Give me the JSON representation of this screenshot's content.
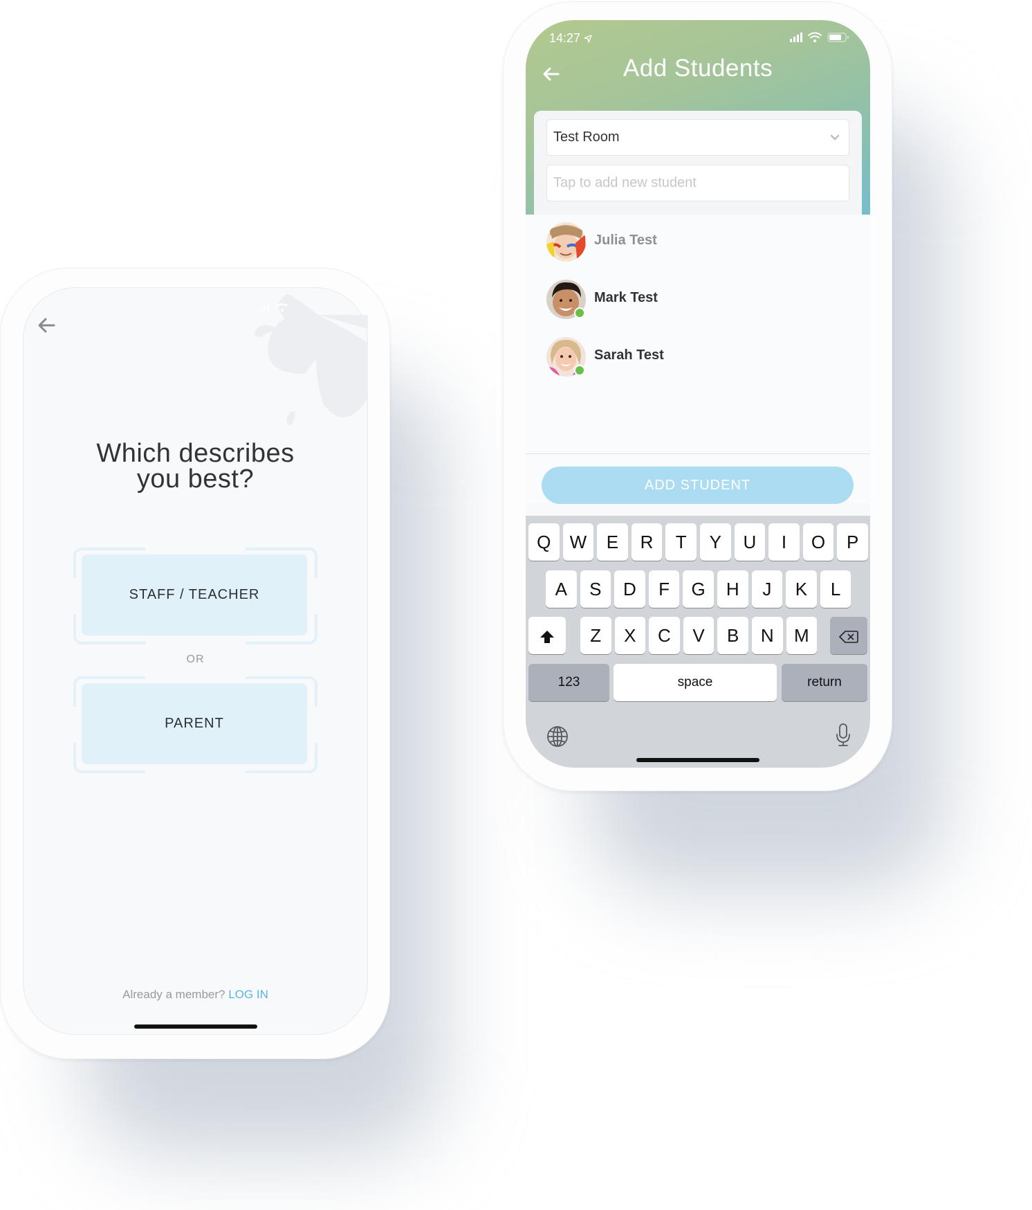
{
  "left_phone": {
    "title_line1": "Which describes",
    "title_line2": "you best?",
    "options": [
      {
        "label": "STAFF / TEACHER"
      },
      {
        "label": "PARENT"
      }
    ],
    "separator": "OR",
    "footer_text": "Already a member?",
    "footer_link": "LOG IN"
  },
  "right_phone": {
    "status": {
      "time": "14:27"
    },
    "header": {
      "title": "Add Students"
    },
    "room_select": {
      "value": "Test Room"
    },
    "new_student_input": {
      "placeholder": "Tap to add new student",
      "value": ""
    },
    "students": [
      {
        "name": "Julia Test",
        "online": false,
        "dimmed": true
      },
      {
        "name": "Mark Test",
        "online": true,
        "dimmed": false
      },
      {
        "name": "Sarah Test",
        "online": true,
        "dimmed": false
      }
    ],
    "add_button": {
      "label": "ADD STUDENT"
    },
    "keyboard": {
      "row1": [
        "Q",
        "W",
        "E",
        "R",
        "T",
        "Y",
        "U",
        "I",
        "O",
        "P"
      ],
      "row2": [
        "A",
        "S",
        "D",
        "F",
        "G",
        "H",
        "J",
        "K",
        "L"
      ],
      "row3": [
        "Z",
        "X",
        "C",
        "V",
        "B",
        "N",
        "M"
      ],
      "numbers": "123",
      "space": "space",
      "return": "return"
    }
  },
  "colors": {
    "accent_blue": "#5ab4e5",
    "button_blue": "#abdcf2",
    "option_fill": "#e1f1fa",
    "online_green": "#6abf4b",
    "header_gradient_start": "#b3c98e",
    "header_gradient_end": "#6cbcd8"
  }
}
